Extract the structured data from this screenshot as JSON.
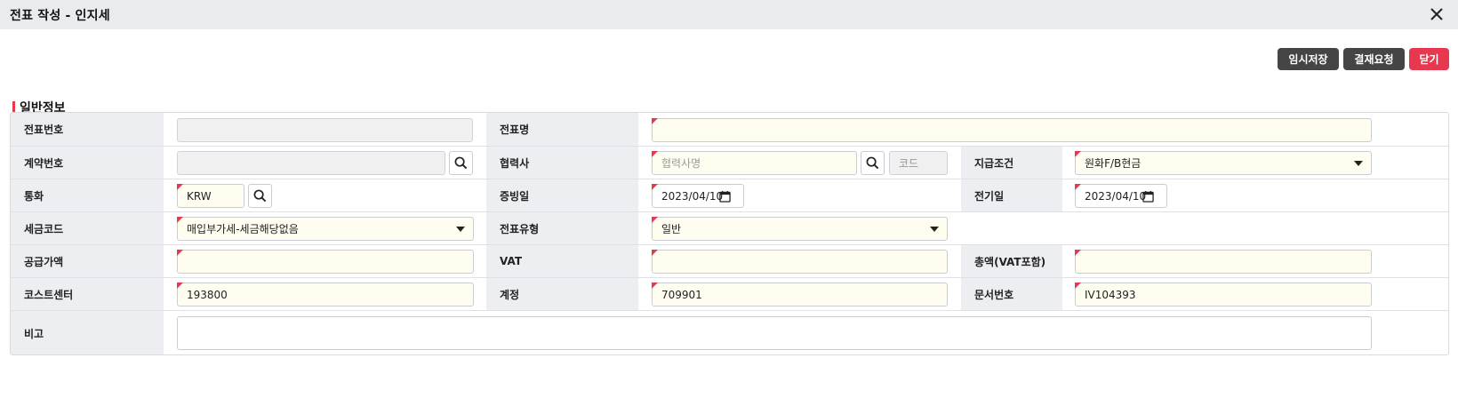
{
  "window": {
    "title": "전표 작성 - 인지세",
    "close_icon": "close-icon"
  },
  "toolbar": {
    "temp_save_label": "임시저장",
    "approval_label": "결재요청",
    "close_label": "닫기"
  },
  "section": {
    "title": "일반정보",
    "accent": "#e8384f"
  },
  "form": {
    "voucher_no": {
      "label": "전표번호",
      "value": ""
    },
    "voucher_name": {
      "label": "전표명",
      "value": ""
    },
    "contract_no": {
      "label": "계약번호",
      "value": ""
    },
    "partner": {
      "label": "협력사",
      "placeholder": "협력사명",
      "code_placeholder": "코드"
    },
    "payment_terms": {
      "label": "지급조건",
      "value": "원화F/B현금"
    },
    "currency": {
      "label": "통화",
      "value": "KRW"
    },
    "evidence_date": {
      "label": "증빙일",
      "value": "2023/04/10"
    },
    "posting_date": {
      "label": "전기일",
      "value": "2023/04/10"
    },
    "tax_code": {
      "label": "세금코드",
      "value": "매입부가세-세금해당없음"
    },
    "voucher_type": {
      "label": "전표유형",
      "value": "일반"
    },
    "supply_amount": {
      "label": "공급가액",
      "value": ""
    },
    "vat": {
      "label": "VAT",
      "value": ""
    },
    "total_amount": {
      "label": "총액(VAT포함)",
      "value": ""
    },
    "cost_center": {
      "label": "코스트센터",
      "value": "193800"
    },
    "account": {
      "label": "계정",
      "value": "709901"
    },
    "document_no": {
      "label": "문서번호",
      "value": "IV104393"
    },
    "remarks": {
      "label": "비고",
      "value": ""
    }
  }
}
